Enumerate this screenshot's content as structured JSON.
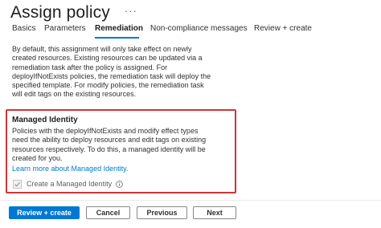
{
  "header": {
    "title": "Assign policy",
    "more": "···"
  },
  "tabs": [
    {
      "label": "Basics"
    },
    {
      "label": "Parameters"
    },
    {
      "label": "Remediation"
    },
    {
      "label": "Non-compliance messages"
    },
    {
      "label": "Review + create"
    }
  ],
  "intro": {
    "lines": [
      "By default, this assignment will only take effect on newly",
      "created resources. Existing resources can be updated via a",
      "remediation task after the policy is assigned. For",
      "deployIfNotExists policies, the remediation task will deploy the",
      "specified template. For modify policies, the remediation task",
      "will edit tags on the existing resources."
    ]
  },
  "managed_identity": {
    "heading": "Managed Identity",
    "lines": [
      "Policies with the deployIfNotExists and modify effect types",
      "need the ability to deploy resources and edit tags on existing",
      "resources respectively. To do this, a managed identity will be",
      "created for you."
    ],
    "link": "Learn more about Managed Identity.",
    "checkbox_label": "Create a Managed Identity",
    "checkbox_checked": true,
    "checkbox_disabled": true
  },
  "footer": {
    "review_create": "Review + create",
    "cancel": "Cancel",
    "previous": "Previous",
    "next": "Next"
  },
  "colors": {
    "accent": "#0078d4",
    "highlight_border": "#d13438"
  }
}
